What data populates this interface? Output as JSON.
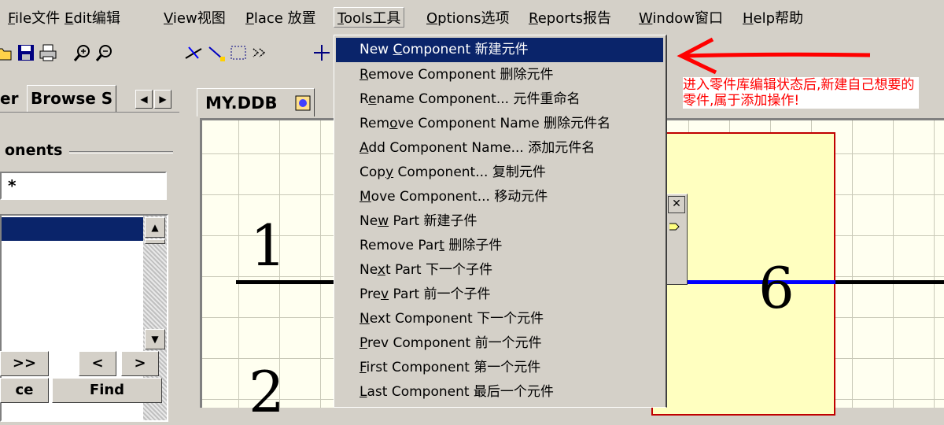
{
  "menubar": {
    "items": [
      {
        "pre": "",
        "ul": "F",
        "post": "ile文件",
        "label": "File文件"
      },
      {
        "pre": "",
        "ul": "E",
        "post": "dit编辑",
        "label": "Edit编辑"
      },
      {
        "pre": "",
        "ul": "V",
        "post": "iew视图",
        "label": "View视图"
      },
      {
        "pre": "",
        "ul": "P",
        "post": "lace 放置",
        "label": "Place 放置"
      },
      {
        "pre": "",
        "ul": "T",
        "post": "ools工具",
        "label": "Tools工具"
      },
      {
        "pre": "",
        "ul": "O",
        "post": "ptions选项",
        "label": "Options选项"
      },
      {
        "pre": "",
        "ul": "R",
        "post": "eports报告",
        "label": "Reports报告"
      },
      {
        "pre": "",
        "ul": "W",
        "post": "indow窗口",
        "label": "Window窗口"
      },
      {
        "pre": "",
        "ul": "H",
        "post": "elp帮助",
        "label": "Help帮助"
      }
    ],
    "active": "Tools工具"
  },
  "toolbar": {
    "icons": [
      "open-icon",
      "save-icon",
      "print-icon",
      "zoom-in-icon",
      "zoom-out-icon",
      "cut-wire-icon",
      "draw-line-icon",
      "select-rect-icon",
      "move-selection-icon",
      "crosshair-icon"
    ]
  },
  "left_panel": {
    "tab_partial_left": "er",
    "tab_browse": "Browse S",
    "arrow_left": "◀",
    "arrow_right": "▶",
    "group_title": "onents",
    "filter_value": "*",
    "nav_buttons": [
      ">>",
      "<",
      ">"
    ],
    "bottom_left": "ce",
    "find_label": "Find"
  },
  "document": {
    "tab_label": "MY.DDB",
    "pin_numbers": [
      "1",
      "2",
      "6"
    ]
  },
  "tools_menu": {
    "items": [
      {
        "pre": "New ",
        "ul": "C",
        "post": "omponent 新建元件",
        "highlighted": true
      },
      {
        "pre": "",
        "ul": "R",
        "post": "emove Component 删除元件"
      },
      {
        "pre": "R",
        "ul": "e",
        "post": "name Component... 元件重命名"
      },
      {
        "pre": "Rem",
        "ul": "o",
        "post": "ve Component Name 删除元件名"
      },
      {
        "pre": "",
        "ul": "A",
        "post": "dd Component Name... 添加元件名"
      },
      {
        "pre": "Cop",
        "ul": "y",
        "post": " Component... 复制元件"
      },
      {
        "pre": "",
        "ul": "M",
        "post": "ove Component... 移动元件"
      },
      {
        "pre": "Ne",
        "ul": "w",
        "post": " Part 新建子件"
      },
      {
        "pre": "Remove Par",
        "ul": "t",
        "post": " 删除子件"
      },
      {
        "pre": "Ne",
        "ul": "x",
        "post": "t Part 下一个子件"
      },
      {
        "pre": "Pre",
        "ul": "v",
        "post": " Part 前一个子件"
      },
      {
        "pre": "",
        "ul": "N",
        "post": "ext Component 下一个元件"
      },
      {
        "pre": "",
        "ul": "P",
        "post": "rev Component 前一个元件"
      },
      {
        "pre": "",
        "ul": "F",
        "post": "irst Component 第一个元件"
      },
      {
        "pre": "",
        "ul": "L",
        "post": "ast Component 最后一个元件"
      }
    ]
  },
  "annotation": {
    "text": "进入零件库编辑状态后,新建自己想要的零件,属于添加操作!",
    "color": "#ff0000"
  },
  "colors": {
    "highlight": "#0a246a",
    "canvas": "#fffff0",
    "component_body": "#ffffc0",
    "component_border": "#c00000",
    "pin_blue": "#0000ff"
  }
}
